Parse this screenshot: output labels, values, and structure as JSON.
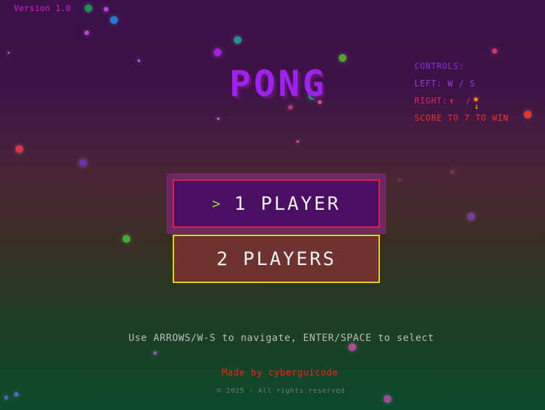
{
  "version": "Version 1.0",
  "title": "PONG",
  "controls": {
    "heading": "CONTROLS:",
    "left": "LEFT: W / S",
    "right_prefix": "RIGHT:",
    "right_up_icon": "arrow-up",
    "right_separator": "/",
    "right_down_icon": "arrow-down",
    "score": "SCORE TO 7 TO WIN"
  },
  "menu": {
    "selected_indicator": ">",
    "items": [
      {
        "label": "1 PLAYER",
        "selected": true
      },
      {
        "label": "2 PLAYERS",
        "selected": false
      }
    ]
  },
  "instructions": "Use ARROWS/W-S to navigate, ENTER/SPACE to select",
  "credit": "Made by cyberguicode",
  "copyright": "© 2025 - All rights reserved",
  "colors": {
    "title": "#a020f0",
    "selected_border": "#e0214a",
    "unselected_border": "#e6d81c",
    "selector_arrow": "#8bd83a",
    "credit": "#ff1e1e"
  }
}
